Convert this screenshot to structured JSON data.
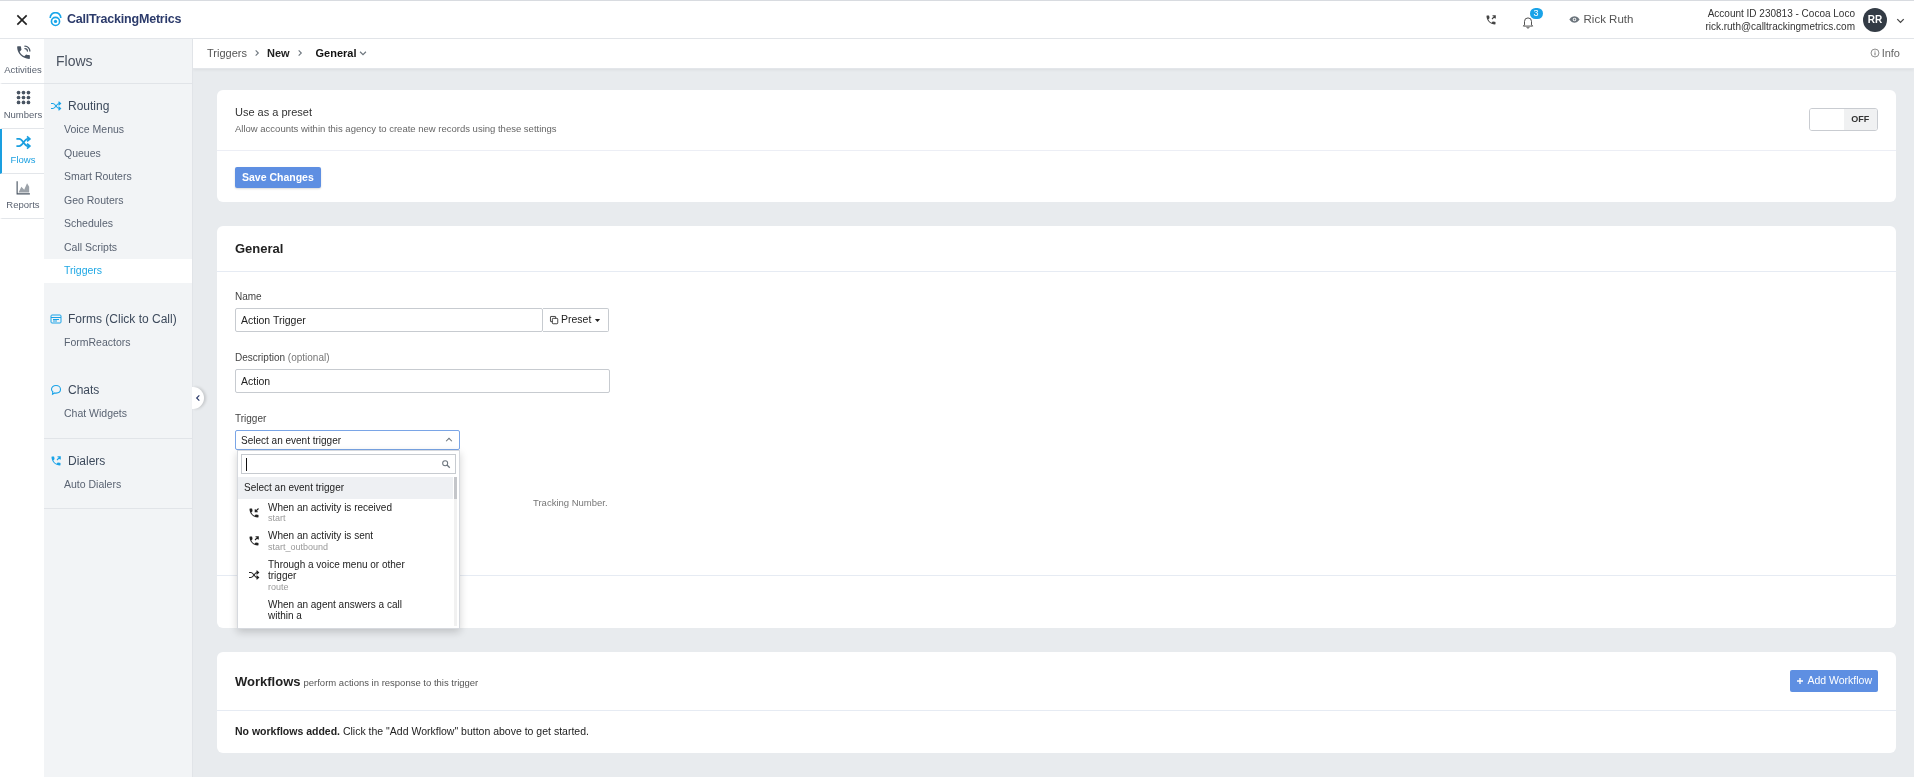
{
  "header": {
    "logo": "CallTrackingMetrics",
    "notifications": "3",
    "viewing_as": "Rick Ruth",
    "account": "Account ID 230813  -  Cocoa Loco",
    "email": "rick.ruth@calltrackingmetrics.com",
    "avatar": "RR"
  },
  "rail": [
    {
      "label": "Activities",
      "selected": false
    },
    {
      "label": "Numbers",
      "selected": false
    },
    {
      "label": "Flows",
      "selected": true
    },
    {
      "label": "Reports",
      "selected": false
    }
  ],
  "sidebar": {
    "title": "Flows",
    "groups": [
      {
        "label": "Routing",
        "items": [
          {
            "label": "Voice Menus",
            "selected": false
          },
          {
            "label": "Queues",
            "selected": false
          },
          {
            "label": "Smart Routers",
            "selected": false
          },
          {
            "label": "Geo Routers",
            "selected": false
          },
          {
            "label": "Schedules",
            "selected": false
          },
          {
            "label": "Call Scripts",
            "selected": false
          },
          {
            "label": "Triggers",
            "selected": true
          }
        ]
      },
      {
        "label": "Forms (Click to Call)",
        "items": [
          {
            "label": "FormReactors",
            "selected": false
          }
        ]
      },
      {
        "label": "Chats",
        "items": [
          {
            "label": "Chat Widgets",
            "selected": false
          }
        ]
      },
      {
        "label": "Dialers",
        "items": [
          {
            "label": "Auto Dialers",
            "selected": false
          }
        ]
      }
    ]
  },
  "breadcrumb": [
    {
      "label": "Triggers",
      "kind": "link"
    },
    {
      "label": "New",
      "kind": "text"
    },
    {
      "label": "General",
      "kind": "menu"
    }
  ],
  "info": "Info",
  "preset": {
    "title": "Use as a preset",
    "description": "Allow accounts within this agency to create new records using these settings",
    "toggle": {
      "label": "OFF",
      "on": false
    },
    "save_button": "Save Changes"
  },
  "general": {
    "title": "General",
    "name": {
      "label": "Name",
      "value": "Action Trigger",
      "button": "Preset"
    },
    "description": {
      "label": "Description",
      "hint": "(optional)",
      "value": "Action"
    },
    "trigger": {
      "label": "Trigger",
      "value": "Select an event trigger",
      "expanded": true,
      "options": [
        {
          "label": "Select an event trigger",
          "selected": true
        },
        {
          "label": "When an activity is received",
          "code": "start",
          "selected": false
        },
        {
          "label": "When an activity is sent",
          "code": "start_outbound",
          "selected": false
        },
        {
          "label": "Through a voice menu or other trigger",
          "code": "route",
          "selected": false
        },
        {
          "label": "When an agent answers a call within a",
          "selected": false
        }
      ]
    },
    "note": "Tracking Number."
  },
  "workflows": {
    "title": "Workflows",
    "subtitle": "perform actions in response to this trigger",
    "add_button": "Add Workflow",
    "empty": "**No workflows added.** Click the \"Add Workflow\" button above to get started."
  }
}
